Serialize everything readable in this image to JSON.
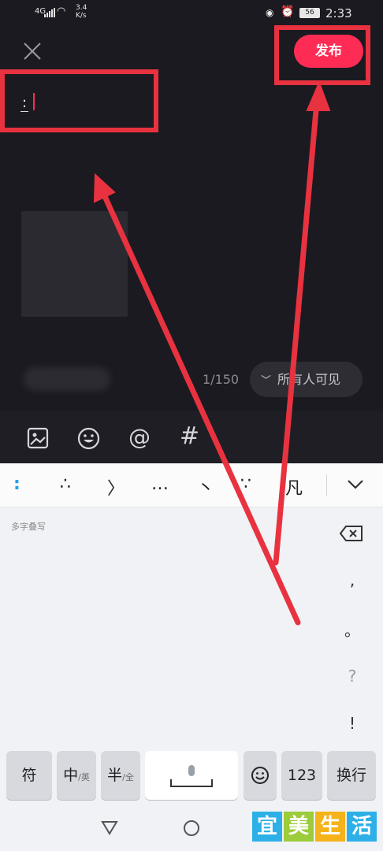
{
  "status_bar": {
    "network": "4G",
    "speed_value": "3.4",
    "speed_unit": "K/s",
    "battery": "56",
    "time": "2:33"
  },
  "header": {
    "close_icon": "close-icon",
    "publish_label": "发布"
  },
  "editor": {
    "text": ":"
  },
  "post": {
    "counter": "1/150",
    "visibility_label": "所有人可见"
  },
  "toolbar": {
    "icons": [
      "image-icon",
      "emoji-icon",
      "at-icon",
      "hashtag-icon"
    ],
    "at_glyph": "@",
    "hash_glyph": "#"
  },
  "keyboard": {
    "candidates": [
      ":",
      "∴",
      "〉",
      "…",
      "丶",
      "∵",
      "凡"
    ],
    "hint": "多字叠写",
    "side_keys": [
      ",",
      "。",
      "?",
      "!"
    ],
    "bottom_row": {
      "symbols": "符",
      "lang_main": "中",
      "lang_sub": "/英",
      "width_main": "半",
      "width_sub": "/全",
      "numbers": "123",
      "enter": "换行"
    }
  },
  "watermark": {
    "chars": [
      "宜",
      "美",
      "生",
      "活"
    ],
    "colors": [
      "#2db0e8",
      "#9ccc3a",
      "#f5b31b",
      "#2db0e8"
    ]
  },
  "colors": {
    "accent": "#fe2c55",
    "annotation": "#e9323f",
    "candidate_active": "#21a0ee"
  }
}
